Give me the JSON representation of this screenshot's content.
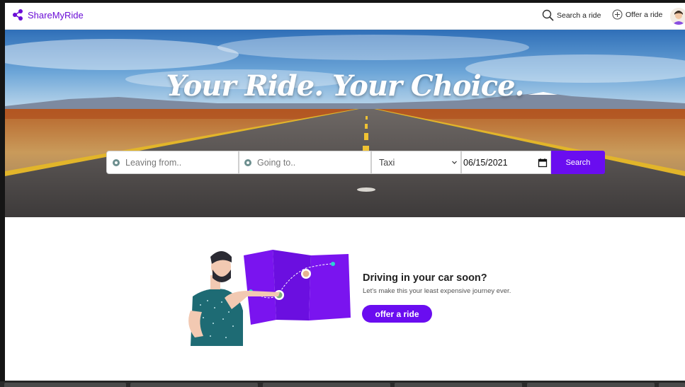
{
  "nav": {
    "brand": "ShareMyRide",
    "search_link": "Search a ride",
    "offer_link": "Offer a ride"
  },
  "hero": {
    "title": "Your Ride. Your Choice.",
    "from_placeholder": "Leaving from..",
    "to_placeholder": "Going to..",
    "ride_type": "Taxi",
    "date": "06/15/2021",
    "search_label": "Search"
  },
  "offer": {
    "title": "Driving in your car soon?",
    "subtitle": "Let's make this your least expensive journey ever.",
    "button": "offer a ride"
  },
  "colors": {
    "accent": "#6a0df0",
    "brand": "#6a0dd6"
  }
}
